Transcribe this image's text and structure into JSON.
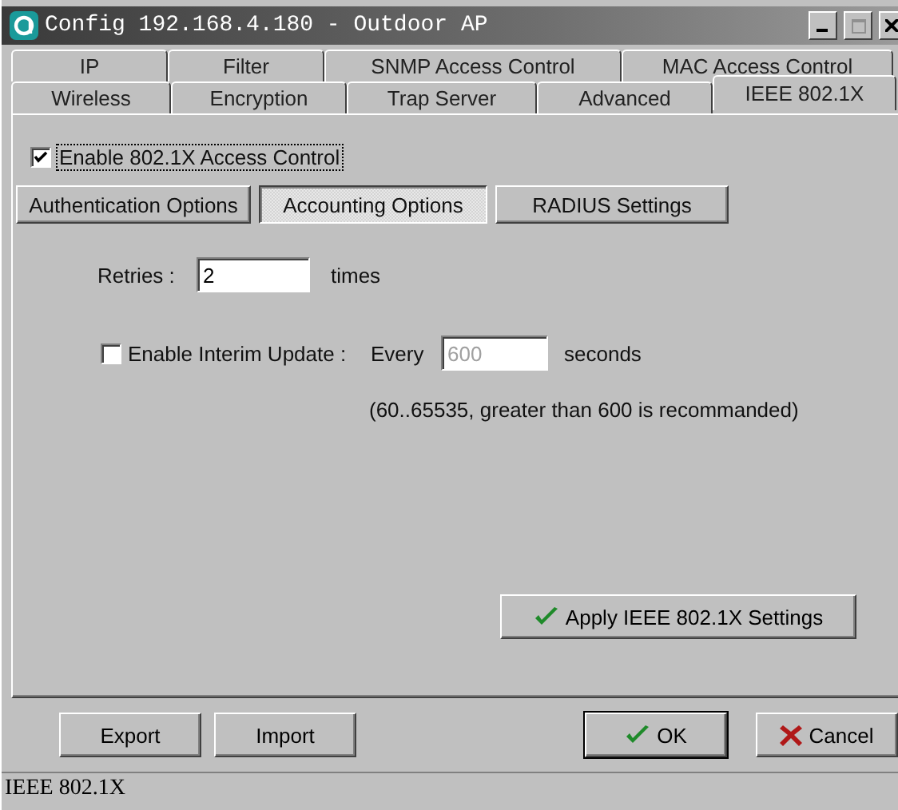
{
  "window": {
    "title": "Config 192.168.4.180 - Outdoor AP"
  },
  "tab_rows": [
    {
      "tabs": [
        {
          "label": "IP",
          "selected": false
        },
        {
          "label": "Filter",
          "selected": false
        },
        {
          "label": "SNMP Access Control",
          "selected": false
        },
        {
          "label": "MAC Access Control",
          "selected": false
        }
      ]
    },
    {
      "tabs": [
        {
          "label": "Wireless",
          "selected": false
        },
        {
          "label": "Encryption",
          "selected": false
        },
        {
          "label": "Trap Server",
          "selected": false
        },
        {
          "label": "Advanced",
          "selected": false
        },
        {
          "label": "IEEE 802.1X",
          "selected": true
        }
      ]
    }
  ],
  "enable_access_control": {
    "label": "Enable 802.1X Access Control",
    "checked": true
  },
  "sub_tabs": [
    {
      "label": "Authentication Options",
      "selected": false
    },
    {
      "label": "Accounting Options",
      "selected": true
    },
    {
      "label": "RADIUS Settings",
      "selected": false
    }
  ],
  "retries": {
    "label": "Retries :",
    "value": "2",
    "unit": "times"
  },
  "interim_update": {
    "label": "Enable Interim Update :",
    "checked": false,
    "every": "Every",
    "value": "600",
    "disabled": true,
    "unit": "seconds",
    "hint": "(60..65535, greater than 600 is recommanded)"
  },
  "apply_button": {
    "label": "Apply IEEE 802.1X Settings",
    "kind": "ok"
  },
  "buttons": [
    {
      "label": "Export",
      "kind": "plain"
    },
    {
      "label": "Import",
      "kind": "plain"
    },
    {
      "label": "OK",
      "kind": "ok"
    },
    {
      "label": "Cancel",
      "kind": "cancel"
    }
  ],
  "status_bar": "IEEE 802.1X"
}
